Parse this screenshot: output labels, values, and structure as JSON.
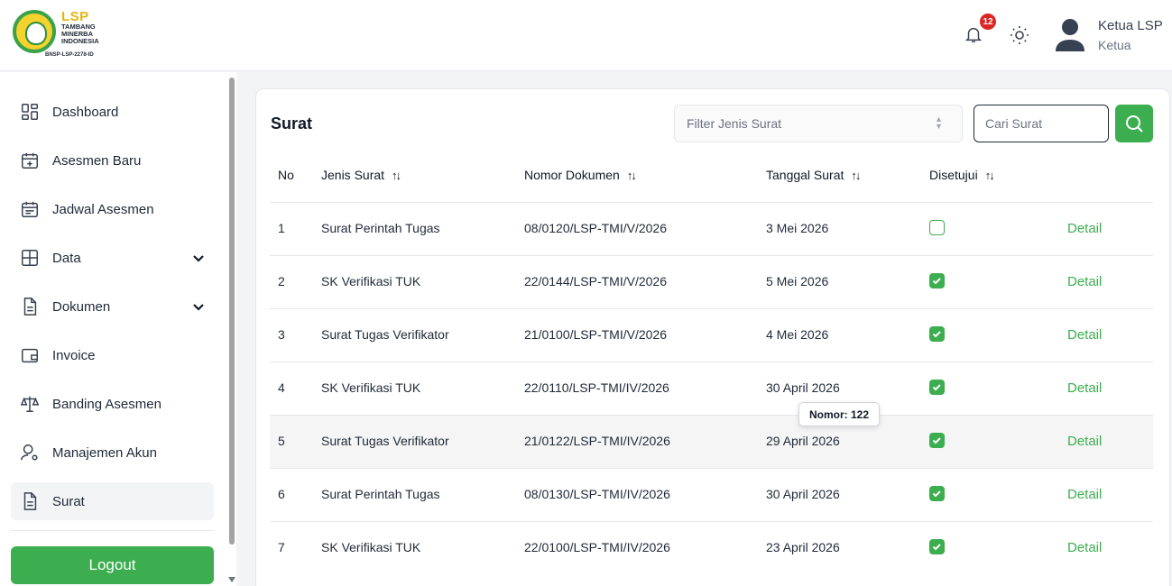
{
  "brand": {
    "logo_title": "LSP",
    "logo_line1": "TAMBANG",
    "logo_line2": "MINERBA",
    "logo_line3": "INDONESIA",
    "logo_code": "BNSP-LSP-2278-ID"
  },
  "header": {
    "notification_count": "12",
    "user_name": "Ketua LSP",
    "user_role": "Ketua"
  },
  "sidebar": {
    "items": [
      {
        "label": "Dashboard",
        "icon": "dashboard-icon"
      },
      {
        "label": "Asesmen Baru",
        "icon": "calendar-plus-icon"
      },
      {
        "label": "Jadwal Asesmen",
        "icon": "calendar-icon"
      },
      {
        "label": "Data",
        "icon": "table-icon"
      },
      {
        "label": "Dokumen",
        "icon": "document-icon"
      },
      {
        "label": "Invoice",
        "icon": "wallet-icon"
      },
      {
        "label": "Banding Asesmen",
        "icon": "scale-icon"
      },
      {
        "label": "Manajemen Akun",
        "icon": "user-gear-icon"
      },
      {
        "label": "Surat",
        "icon": "document-icon"
      }
    ],
    "active": "Surat",
    "logout_label": "Logout"
  },
  "main": {
    "title": "Surat",
    "filter_placeholder": "Filter Jenis Surat",
    "search_placeholder": "Cari Surat",
    "columns": [
      "No",
      "Jenis Surat",
      "Nomor Dokumen",
      "Tanggal Surat",
      "Disetujui"
    ],
    "detail_label": "Detail",
    "rows": [
      {
        "no": "1",
        "jenis": "Surat Perintah Tugas",
        "nomor": "08/0120/LSP-TMI/V/2026",
        "tanggal": "3 Mei 2026",
        "disetujui": false
      },
      {
        "no": "2",
        "jenis": "SK Verifikasi TUK",
        "nomor": "22/0144/LSP-TMI/V/2026",
        "tanggal": "5 Mei 2026",
        "disetujui": true
      },
      {
        "no": "3",
        "jenis": "Surat Tugas Verifikator",
        "nomor": "21/0100/LSP-TMI/V/2026",
        "tanggal": "4 Mei 2026",
        "disetujui": true
      },
      {
        "no": "4",
        "jenis": "SK Verifikasi TUK",
        "nomor": "22/0110/LSP-TMI/IV/2026",
        "tanggal": "30 April 2026",
        "disetujui": true
      },
      {
        "no": "5",
        "jenis": "Surat Tugas Verifikator",
        "nomor": "21/0122/LSP-TMI/IV/2026",
        "tanggal": "29 April 2026",
        "disetujui": true
      },
      {
        "no": "6",
        "jenis": "Surat Perintah Tugas",
        "nomor": "08/0130/LSP-TMI/IV/2026",
        "tanggal": "30 April 2026",
        "disetujui": true
      },
      {
        "no": "7",
        "jenis": "SK Verifikasi TUK",
        "nomor": "22/0100/LSP-TMI/IV/2026",
        "tanggal": "23 April 2026",
        "disetujui": true
      }
    ],
    "tooltip": "Nomor: 122"
  },
  "colors": {
    "accent": "#3cae4f",
    "badge": "#dc2626"
  }
}
